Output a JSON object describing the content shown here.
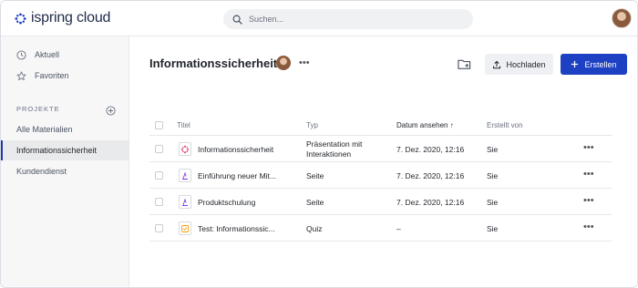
{
  "header": {
    "logo_text": "ispring cloud",
    "search_placeholder": "Suchen..."
  },
  "sidebar": {
    "nav": [
      {
        "label": "Aktuell",
        "icon": "clock-icon"
      },
      {
        "label": "Favoriten",
        "icon": "star-icon"
      }
    ],
    "projects_heading": "PROJEKTE",
    "projects": [
      {
        "label": "Alle Materialien",
        "active": false
      },
      {
        "label": "Informationssicherheit",
        "active": true
      },
      {
        "label": "Kundendienst",
        "active": false
      }
    ]
  },
  "main": {
    "title": "Informationssicherheit",
    "more": "•••",
    "upload_label": "Hochladen",
    "create_label": "Erstellen",
    "accent": "#1e40c2"
  },
  "table": {
    "columns": {
      "title": "Titel",
      "type": "Typ",
      "date": "Datum ansehen",
      "date_sort": "↑",
      "by": "Erstellt von"
    },
    "rows": [
      {
        "name": "Informationssicherheit",
        "type": "Präsentation mit Interaktionen",
        "date": "7. Dez. 2020, 12:16",
        "by": "Sie",
        "icon": "presentation-icon",
        "more": "•••"
      },
      {
        "name": "Einführung neuer Mit...",
        "type": "Seite",
        "date": "7. Dez. 2020, 12:16",
        "by": "Sie",
        "icon": "page-icon",
        "more": "•••"
      },
      {
        "name": "Produktschulung",
        "type": "Seite",
        "date": "7. Dez. 2020, 12:16",
        "by": "Sie",
        "icon": "page-icon",
        "more": "•••"
      },
      {
        "name": "Test: Informationssic...",
        "type": "Quiz",
        "date": "–",
        "by": "Sie",
        "icon": "quiz-icon",
        "more": "•••"
      }
    ]
  }
}
